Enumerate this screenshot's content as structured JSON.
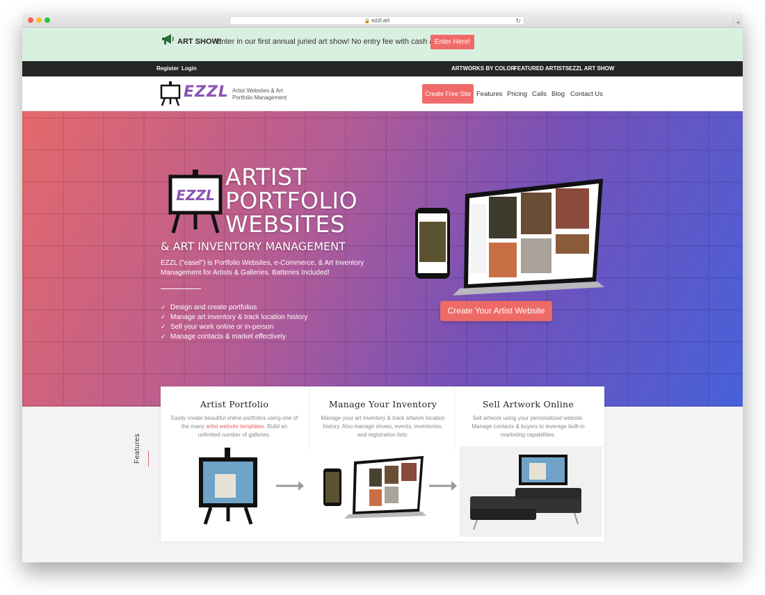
{
  "browser": {
    "url": "ezzl.art"
  },
  "announcement": {
    "title": "ART SHOW!",
    "text": "Enter in our first annual juried art show! No entry fee with cash awards.",
    "button": "Enter Here!"
  },
  "topbar": {
    "left": [
      "Register",
      "Login"
    ],
    "right": [
      "ARTWORKS BY COLOR",
      "FEATURED ARTISTS",
      "EZZL ART SHOW"
    ]
  },
  "nav": {
    "logo_text": "EZZL",
    "tagline": "Artist Websites & Art Portfolio Management",
    "cta": "Create Free Site",
    "links": [
      "Features",
      "Pricing",
      "Calls",
      "Blog",
      "Contact Us"
    ]
  },
  "hero": {
    "logo_text": "EZZL",
    "title_lines": [
      "ARTIST",
      "PORTFOLIO",
      "WEBSITES"
    ],
    "subtitle": "& ART INVENTORY MANAGEMENT",
    "description": "EZZL (\"easel\") is Portfolio Websites, e-Commerce, & Art Inventory Management for Artists & Galleries. Batteries Included!",
    "bullets": [
      "Design and create portfolios",
      "Manage art inventory & track location history",
      "Sell your work online or in-person",
      "Manage contacts & market effectively"
    ],
    "cta": "Create Your Artist Website"
  },
  "features": {
    "tab_label": "Features",
    "columns": [
      {
        "title": "Artist Portfolio",
        "text_before": "Easily create beautiful online portfolios using one of the many ",
        "link": "artist website templates",
        "text_after": ". Build an unlimited number of galleries."
      },
      {
        "title": "Manage Your Inventory",
        "text": "Manage your art inventory & track artwork location history. Also manage shows, events, inventories, and registration lists."
      },
      {
        "title": "Sell Artwork Online",
        "text": "Sell artwork using your personalized website. Manage contacts & buyers to leverage built-in marketing capabilities."
      }
    ]
  },
  "colors": {
    "accent": "#f06a6a",
    "announce_bg": "#d9efe0",
    "topbar_bg": "#232526",
    "logo_purple": "#8b54b5"
  }
}
